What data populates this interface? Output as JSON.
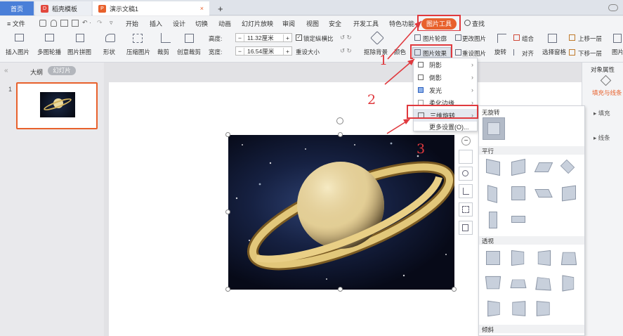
{
  "tabs": [
    {
      "label": "首页",
      "active": false
    },
    {
      "label": "稻壳模板",
      "icon": "D"
    },
    {
      "label": "演示文稿1",
      "icon": "P",
      "close": "×"
    }
  ],
  "tab_add": "+",
  "menu": {
    "file": "≡ 文件",
    "items": [
      "开始",
      "插入",
      "设计",
      "切换",
      "动画",
      "幻灯片放映",
      "审阅",
      "视图",
      "安全",
      "开发工具",
      "特色功能"
    ],
    "active": "图片工具",
    "search": "查找"
  },
  "ribbon": {
    "insert_picture": "插入图片",
    "multi_outline": "多图轮播",
    "picture_collage": "图片拼图",
    "shape": "形状",
    "compress": "压缩图片",
    "crop": "裁剪",
    "creative_crop": "创意裁剪",
    "height_label": "高度:",
    "height_value": "11.32厘米",
    "width_label": "宽度:",
    "width_value": "16.54厘米",
    "lock_ratio": "锁定纵横比",
    "reset_size": "重设大小",
    "remove_bg": "抠除背景",
    "color": "颜色",
    "picture_outline": "图片轮廓",
    "picture_effect": "图片效果",
    "change_picture": "更改图片",
    "reset_picture": "重设图片",
    "rotate": "旋转",
    "combine": "组合",
    "align": "对齐",
    "selection_pane": "选择窗格",
    "bring_forward": "上移一层",
    "send_backward": "下移一层",
    "picture_more": "图片"
  },
  "left": {
    "outline_tab": "大纲",
    "slides_tab": "幻灯片",
    "slide_number": "1"
  },
  "effect_menu": {
    "items": [
      "阴影",
      "倒影",
      "发光",
      "柔化边缘",
      "三维旋转",
      "更多设置(O)..."
    ]
  },
  "rotation_gallery": {
    "no_rotation": "无旋转",
    "parallel": "平行",
    "perspective": "透视",
    "oblique": "倾斜"
  },
  "right_pane": {
    "title": "对象属性",
    "fill_line": "填充与线条",
    "fill": "填充",
    "line": "线条"
  },
  "annotations": [
    "1",
    "2",
    "3"
  ],
  "colors": {
    "accent": "#e8612c",
    "annotation": "#e0393e",
    "tab_active": "#e8612c"
  }
}
